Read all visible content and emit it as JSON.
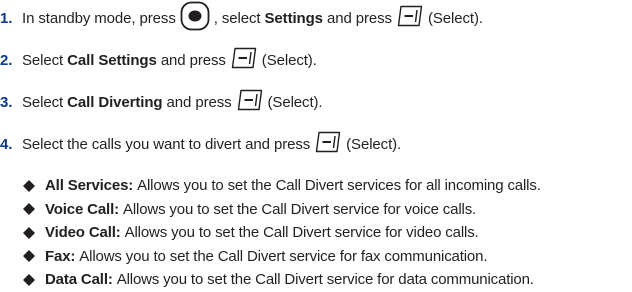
{
  "steps": [
    {
      "number": "1.",
      "t1": "In standby mode, press",
      "t2": ", select",
      "b1": "Settings",
      "t3": "and press",
      "t4": "(Select)."
    },
    {
      "number": "2.",
      "t1": "Select",
      "b1": "Call Settings",
      "t2": "and press",
      "t3": "(Select)."
    },
    {
      "number": "3.",
      "t1": "Select",
      "b1": "Call Diverting",
      "t2": "and press",
      "t3": "(Select)."
    },
    {
      "number": "4.",
      "t1": "Select the calls you want to divert and press",
      "t2": "(Select)."
    }
  ],
  "bullets": [
    {
      "term": "All Services:",
      "desc": "Allows you to set the Call Divert services for all incoming calls."
    },
    {
      "term": "Voice Call:",
      "desc": "Allows you to set the Call Divert service for voice calls."
    },
    {
      "term": "Video Call:",
      "desc": "Allows you to set the Call Divert service for video calls."
    },
    {
      "term": "Fax:",
      "desc": "Allows you to set the Call Divert service for fax communication."
    },
    {
      "term": "Data Call:",
      "desc": "Allows you to set the Call Divert service for data communication."
    }
  ],
  "icons": {
    "center_key": "center-key-icon",
    "softkey": "left-softkey-icon",
    "bullet": "diamond-bullet-icon"
  },
  "colors": {
    "step_number": "#0b3b8c",
    "text": "#231f20"
  }
}
